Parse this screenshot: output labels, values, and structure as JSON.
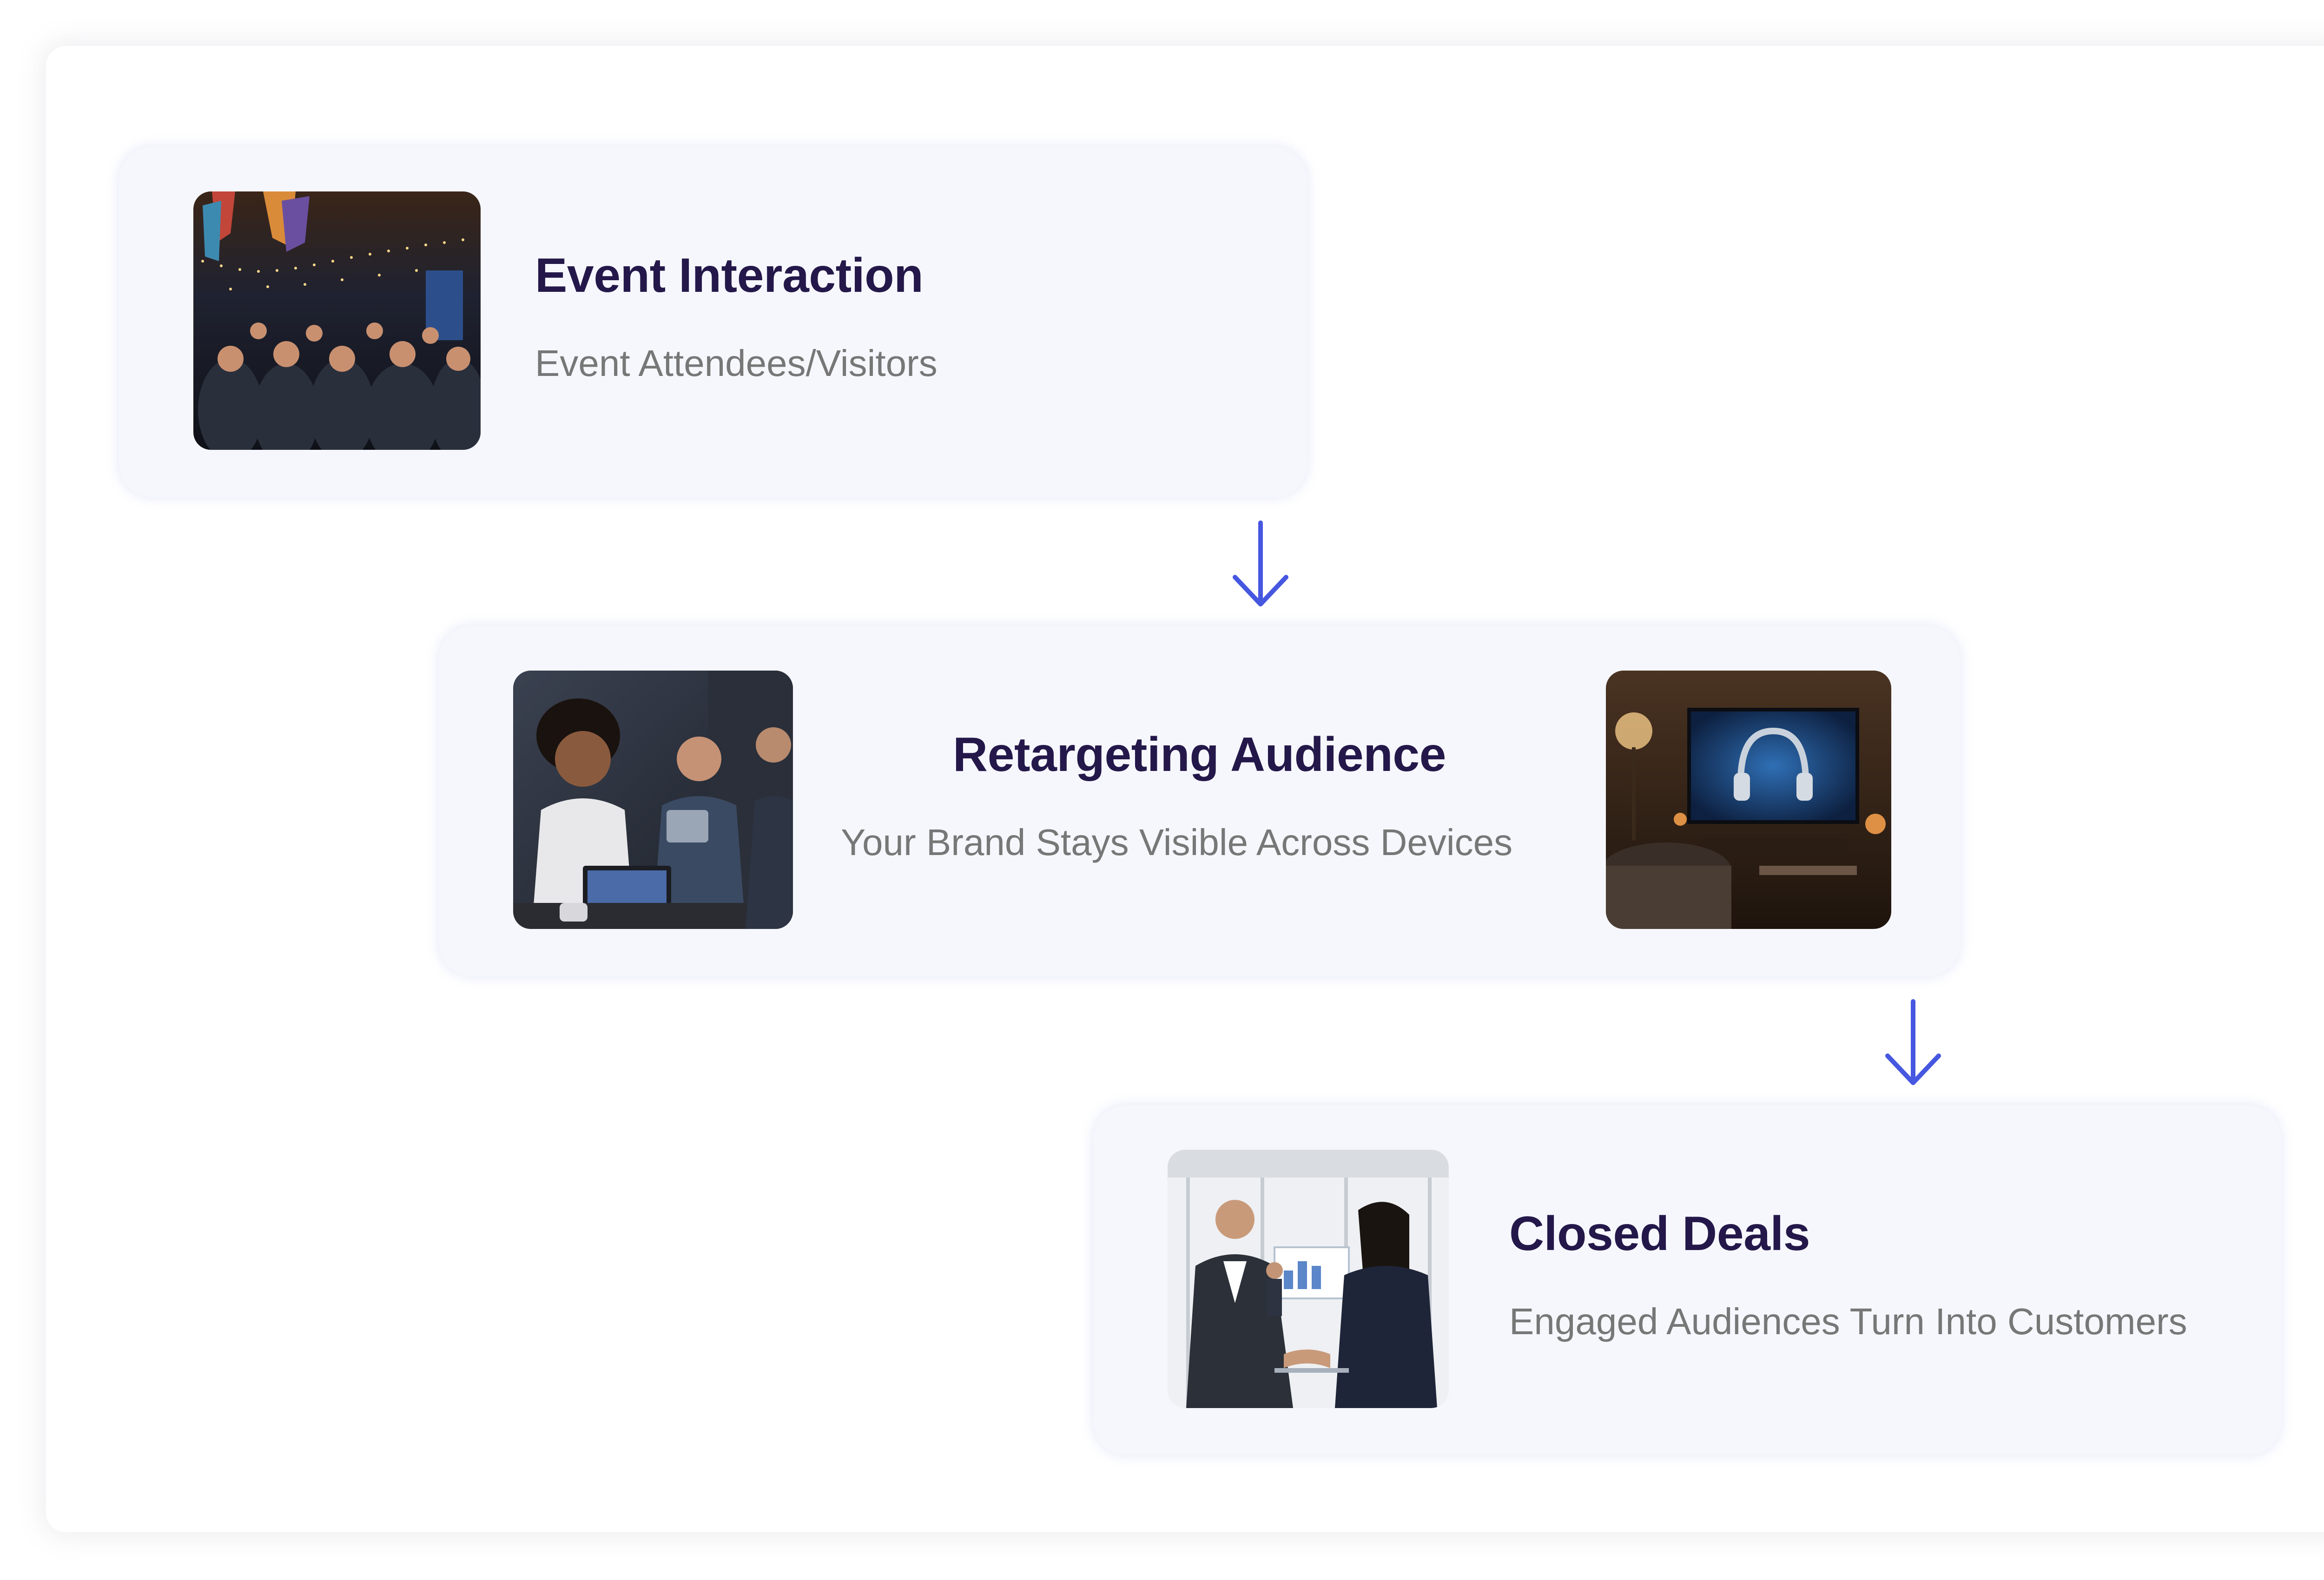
{
  "steps": [
    {
      "title": "Event Interaction",
      "subtitle": "Event Attendees/Visitors"
    },
    {
      "title": "Retargeting Audience",
      "subtitle": "Your Brand Stays Visible Across Devices"
    },
    {
      "title": "Closed Deals",
      "subtitle": "Engaged Audiences Turn Into Customers"
    }
  ],
  "colors": {
    "title": "#24184a",
    "subtitle": "#777777",
    "card_bg": "#f6f7fd",
    "arrow": "#4657e0"
  },
  "icons": {
    "connector_1": "arrow-down-icon",
    "connector_2": "arrow-down-icon"
  }
}
